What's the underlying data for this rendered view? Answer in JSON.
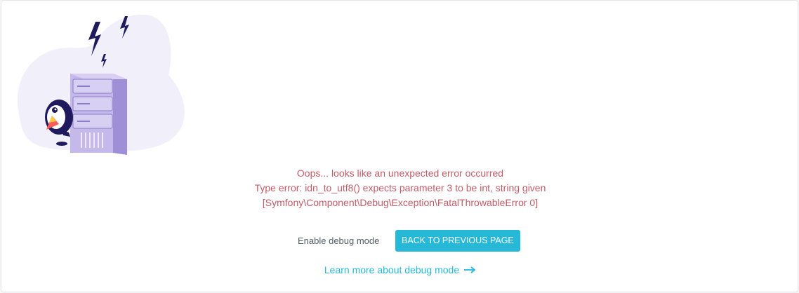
{
  "error": {
    "line1": "Oops... looks like an unexpected error occurred",
    "line2": "Type error: idn_to_utf8() expects parameter 3 to be int, string given",
    "line3": "[Symfony\\Component\\Debug\\Exception\\FatalThrowableError 0]"
  },
  "actions": {
    "debug_label": "Enable debug mode",
    "back_label": "BACK TO PREVIOUS PAGE",
    "learn_more_label": "Learn more about debug mode"
  },
  "icons": {
    "illustration": "server-error-illustration",
    "arrow": "arrow-right-icon"
  },
  "colors": {
    "error_text": "#c05c67",
    "accent": "#25b9d7",
    "illustration_purple": "#c5b9eb"
  }
}
